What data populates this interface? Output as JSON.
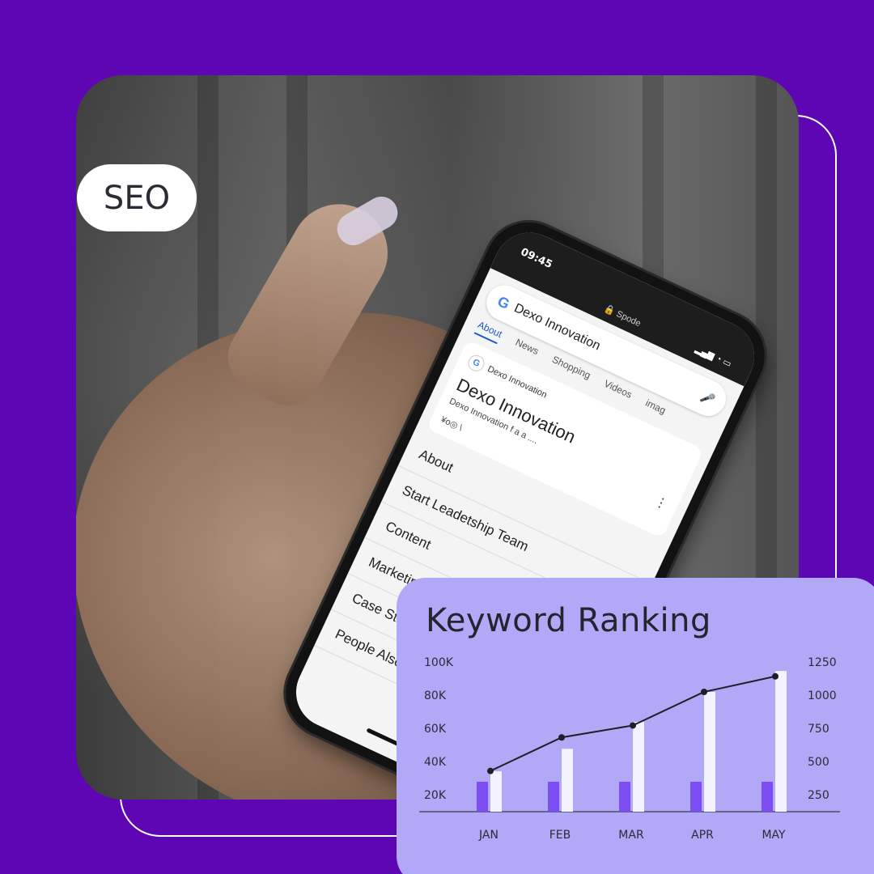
{
  "badge": {
    "label": "SEO"
  },
  "phone": {
    "time": "09:45",
    "url": "Spode",
    "status_icons": "▂▄▆ ◔ ▭",
    "search_query": "Dexo Innovation",
    "tabs": [
      "About",
      "News",
      "Shopping",
      "Videos",
      "imag"
    ],
    "result": {
      "source": "Dexo Innovation",
      "title": "Dexo Innovation",
      "subtitle": "Dexo Innovation f a a ....",
      "subtitle2": "¥o◎ \\"
    },
    "menu": [
      {
        "label": "About",
        "chevron": ""
      },
      {
        "label": "Start Leadetship Team",
        "chevron": "›"
      },
      {
        "label": "Content",
        "chevron": "›"
      },
      {
        "label": "Marketing Services",
        "chevron": "›"
      },
      {
        "label": "Case Studies",
        "chevron": ""
      },
      {
        "label": "People Also Seatch For",
        "chevron": ""
      }
    ]
  },
  "colors": {
    "background": "#5e06b4",
    "card": "#b1a8f7",
    "bar_primary": "#7b4df2",
    "bar_secondary": "#f3f1fd",
    "line": "#1f1f28"
  },
  "chart_data": {
    "type": "bar",
    "title": "Keyword Ranking",
    "categories": [
      "JAN",
      "FEB",
      "MAR",
      "APR",
      "MAY"
    ],
    "series": [
      {
        "axis": "left",
        "values": [
          20,
          20,
          20,
          20,
          20
        ]
      },
      {
        "axis": "left",
        "values": [
          27,
          42,
          60,
          80,
          94
        ]
      },
      {
        "axis": "right",
        "type": "line",
        "values": [
          340,
          620,
          720,
          1000,
          1130
        ]
      }
    ],
    "y_left_ticks": [
      "100K",
      "80K",
      "60K",
      "40K",
      "20K"
    ],
    "y_right_ticks": [
      "1250",
      "1000",
      "750",
      "500",
      "250"
    ],
    "ylim_left": [
      0,
      100
    ],
    "ylim_right": [
      0,
      1250
    ],
    "grid": false
  }
}
